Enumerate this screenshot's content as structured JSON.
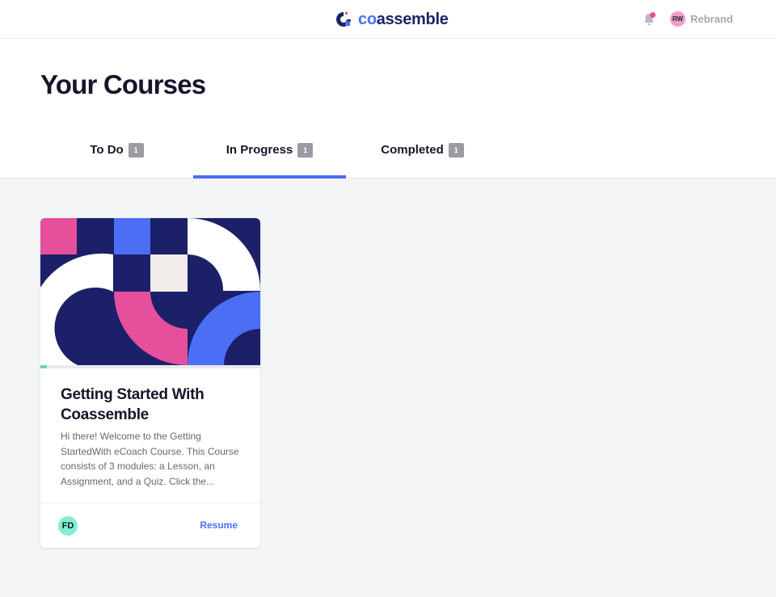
{
  "brand": {
    "logo_co": "co",
    "logo_rest": "assemble"
  },
  "header": {
    "user_initials": "RW",
    "user_name": "Rebrand"
  },
  "page": {
    "title": "Your Courses"
  },
  "tabs": [
    {
      "label": "To Do",
      "count": "1"
    },
    {
      "label": "In Progress",
      "count": "1",
      "active": true
    },
    {
      "label": "Completed",
      "count": "1"
    }
  ],
  "courses": [
    {
      "title": "Getting Started With Coassemble",
      "description": "Hi there! Welcome to the Getting StartedWith eCoach Course. This Course consists of 3 modules: a Lesson, an Assignment, and a Quiz. Click the...",
      "author_initials": "FD",
      "action_label": "Resume",
      "progress": 0.03
    }
  ],
  "colors": {
    "accent": "#4c6ef5",
    "navy": "#1b2565",
    "pink": "#e64f9c",
    "mint": "#5ed8b7"
  },
  "icons": {
    "notifications": "bell-icon"
  }
}
